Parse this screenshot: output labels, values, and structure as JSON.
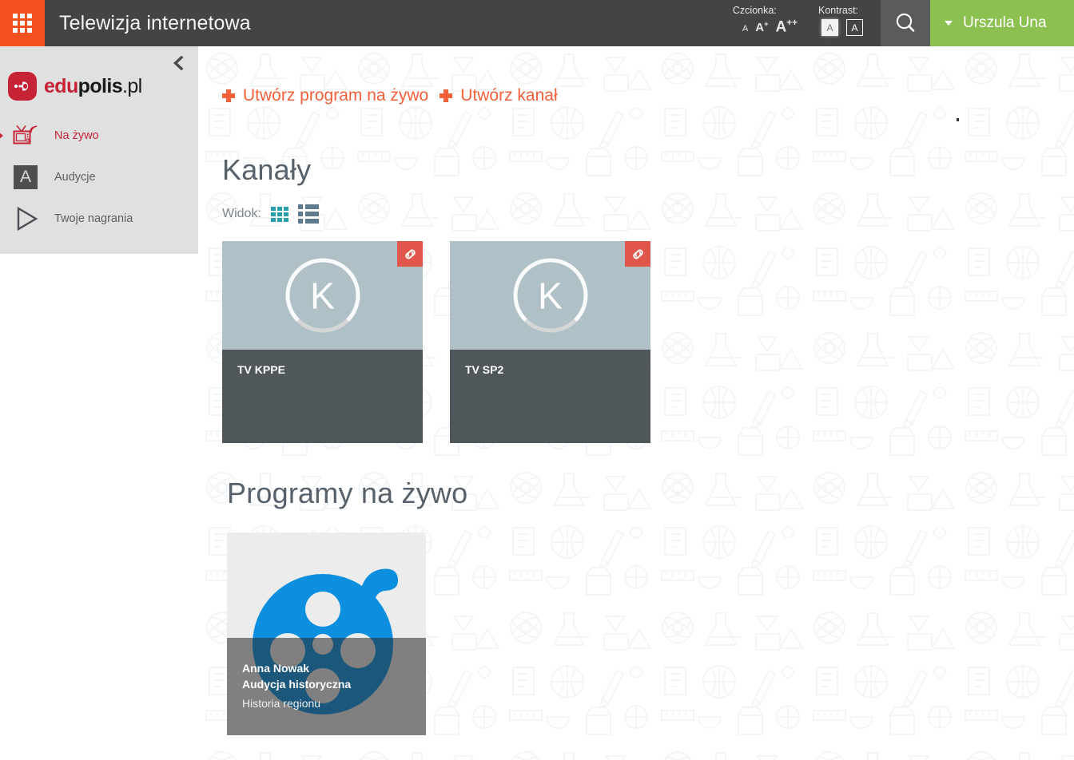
{
  "topbar": {
    "apps_icon": "apps-grid-icon",
    "title": "Telewizja internetowa",
    "font_label": "Czcionka:",
    "font_sizes": [
      {
        "label": "A",
        "sup": ""
      },
      {
        "label": "A",
        "sup": "+"
      },
      {
        "label": "A",
        "sup": "++"
      }
    ],
    "contrast_label": "Kontrast:",
    "contrast_options": [
      {
        "label": "A",
        "mode": "light",
        "active": true
      },
      {
        "label": "A",
        "mode": "dark",
        "active": false
      }
    ],
    "search_icon": "search-icon",
    "user_name": "Urszula Una",
    "accent_orange": "#f4511e",
    "user_green": "#8cc152",
    "bar_gray": "#444444"
  },
  "sidebar": {
    "collapse_icon": "chevron-left-icon",
    "logo": {
      "edu": "edu",
      "polis": "polis",
      "pl": ".pl",
      "mark_color": "#c62336"
    },
    "items": [
      {
        "label": "Na żywo",
        "icon": "tv-live-icon",
        "active": true
      },
      {
        "label": "Audycje",
        "icon": "letter-a-icon",
        "active": false
      },
      {
        "label": "Twoje nagrania",
        "icon": "play-triangle-icon",
        "active": false
      }
    ]
  },
  "main": {
    "actions": [
      {
        "label": "Utwórz program na żywo",
        "icon": "plus-icon"
      },
      {
        "label": "Utwórz kanał",
        "icon": "plus-icon"
      }
    ],
    "channels_heading": "Kanały",
    "view": {
      "label": "Widok:",
      "options": [
        {
          "name": "grid-view",
          "icon": "grid-view-icon",
          "active": true,
          "color": "#27a0ae"
        },
        {
          "name": "list-view",
          "icon": "list-view-icon",
          "active": false,
          "color": "#5e7a8c"
        }
      ]
    },
    "channels": [
      {
        "title": "TV KPPE",
        "avatar_letter": "K",
        "badge_icon": "link-icon"
      },
      {
        "title": "TV SP2",
        "avatar_letter": "K",
        "badge_icon": "link-icon"
      }
    ],
    "programs_heading": "Programy na żywo",
    "programs": [
      {
        "author": "Anna Nowak",
        "name": "Audycja historyczna",
        "subtitle": "Historia regionu",
        "thumb_icon": "film-reel-icon",
        "thumb_color": "#0d8fe0"
      }
    ]
  }
}
